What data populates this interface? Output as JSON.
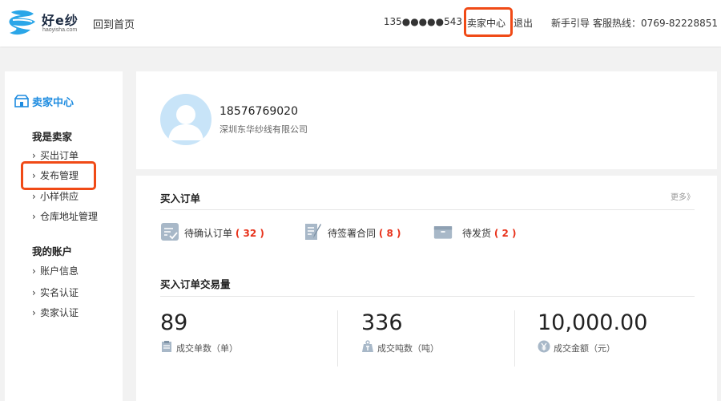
{
  "header": {
    "logo_text": "好e纱",
    "logo_sub": "haoyisha.com",
    "home_link": "回到首页",
    "phone": "135●●●●●543",
    "seller_center": "卖家中心",
    "logout": "退出",
    "guide": "新手引导",
    "hotline": "客服热线：0769-82228851"
  },
  "sidebar": {
    "title": "卖家中心",
    "sections": [
      {
        "title": "我是卖家",
        "items": [
          "买出订单",
          "发布管理",
          "小样供应",
          "仓库地址管理"
        ]
      },
      {
        "title": "我的账户",
        "items": [
          "账户信息",
          "实名认证",
          "卖家认证"
        ]
      }
    ]
  },
  "profile": {
    "phone": "18576769020",
    "company": "深圳东华纱线有限公司"
  },
  "orders": {
    "title": "买入订单",
    "more": "更多》",
    "statuses": [
      {
        "label": "待确认订单",
        "count": "( 32 )"
      },
      {
        "label": "待签署合同",
        "count": "( 8 )"
      },
      {
        "label": "待发货",
        "count": "( 2 )"
      }
    ],
    "volume_title": "买入订单交易量",
    "stats": [
      {
        "value": "89",
        "label": "成交单数（单）"
      },
      {
        "value": "336",
        "label": "成交吨数（吨）"
      },
      {
        "value": "10,000.00",
        "label": "成交金额（元）"
      }
    ]
  },
  "colors": {
    "accent": "#1e8ce0",
    "highlight": "#f04a16",
    "count": "#e8321b"
  }
}
